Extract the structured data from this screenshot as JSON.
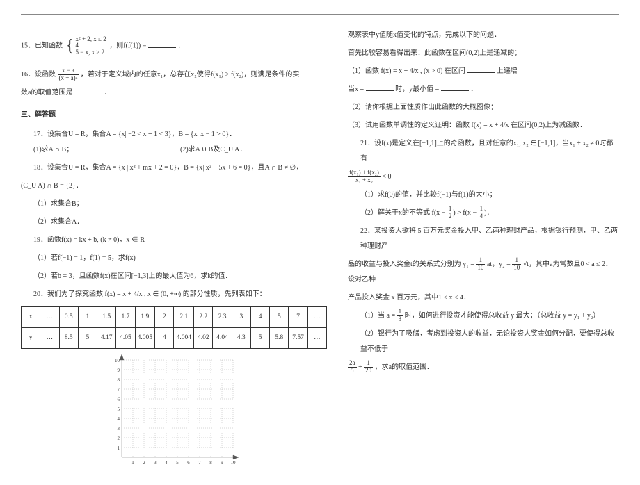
{
  "q15": {
    "prefix": "15．已知函数",
    "fn": "f(x) = ",
    "piece1": "x² + 2, x ≤ 2",
    "piece2": "4",
    "piece3": "5 − x, x > 2",
    "mid": "，则f(f(1)) = ",
    "suffix": "．"
  },
  "q16": {
    "prefix": "16．设函数",
    "fn": "f(x) = (x − a) / (x + a)²",
    "body": "，若对于定义域内的任意x₁，总存在x₂使得f(x₁) > f(x₂)，则满足条件的实",
    "line2": "数a的取值范围是",
    "suffix": "．"
  },
  "sec3": "三、解答题",
  "q17": {
    "line1": "17．设集合U = R，集合A = {x| −2 < x + 1 < 3}，B = {x| x − 1 > 0}．",
    "part1": "(1)求A ∩ B；",
    "part2": "(2)求A ∪ B及C_U A．"
  },
  "q18": {
    "line1": "18．设集合U = R，集合A = {x | x² + mx + 2 = 0}，B = {x| x² − 5x + 6 = 0}，且A ∩ B ≠ ∅，",
    "line2": "(C_U A) ∩ B = {2}．",
    "part1": "（1）求集合B；",
    "part2": "（2）求集合A．"
  },
  "q19": {
    "line1": "19．函数f(x) = kx + b, (k ≠ 0)，x ∈ R",
    "part1": "（1）若f(−1) = 1，f(1) = 5，求f(x)",
    "part2": "（2）若b = 3，且函数f(x)在区间[−1,3]上的最大值为6，求k的值．"
  },
  "q20": {
    "line1_pre": "20．我们为了探究函数",
    "fn": "f(x) = x + 4/x , x ∈ (0, +∞)",
    "line1_post": "的部分性质，先列表如下：",
    "table": {
      "row_x_label": "x",
      "row_y_label": "y",
      "dots": "…",
      "x": [
        "0.5",
        "1",
        "1.5",
        "1.7",
        "1.9",
        "2",
        "2.1",
        "2.2",
        "2.3",
        "3",
        "4",
        "5",
        "7"
      ],
      "y": [
        "8.5",
        "5",
        "4.17",
        "4.05",
        "4.005",
        "4",
        "4.004",
        "4.02",
        "4.04",
        "4.3",
        "5",
        "5.8",
        "7.57"
      ]
    }
  },
  "right": {
    "r1": "观察表中y值随x值变化的特点，完成以下的问题．",
    "r2": "首先比较容易看得出来：此函数在区间(0,2)上是递减的；",
    "r3_pre": "（1）函数",
    "r3_fn": "f(x) = x + 4/x , (x > 0)",
    "r3_mid": "在区间",
    "r3_post": "上递增",
    "r4_a": "当x = ",
    "r4_b": "时，y最小值 = ",
    "r4_c": "．",
    "r5": "（2）请你根据上面性质作出此函数的大概图像；",
    "r6_pre": "（3）试用函数单调性的定义证明：函数",
    "r6_fn": "f(x) = x + 4/x",
    "r6_post": "在区间(0,2)上为减函数．",
    "q21_l1": "21．设f(x)是定义在[−1,1]上的奇函数，且对任意的x₁, x₂ ∈ [−1,1]，当x₁ + x₂ ≠ 0时都有",
    "q21_frac_num": "f(x₁) + f(x₂)",
    "q21_frac_den": "x₁ + x₂",
    "q21_lt": " < 0",
    "q21_p1": "（1）求f(0)的值，并比较f(−1)与f(1)的大小；",
    "q21_p2_pre": "（2）解关于x的不等式",
    "q21_p2_f1n": "1",
    "q21_p2_f1d": "2",
    "q21_p2_mid": "f(x − ) > f(x − )",
    "q21_p2_f2n": "1",
    "q21_p2_f2d": "4",
    "q22_l1": "22．某投资人欲将 5 百万元奖金投入甲、乙两种理财产品，根据银行预测，甲、乙两种理财产",
    "q22_l2_pre": "品的收益与投入奖金t的关系式分别为 y₁ = ",
    "q22_f1n": "1",
    "q22_f1d": "10",
    "q22_l2_mid1": "at，y₂ = ",
    "q22_f2n": "1",
    "q22_f2d": "10",
    "q22_l2_mid2": "√t，其中a为常数且0 < a ≤ 2．设对乙种",
    "q22_l3": "产品投入奖金 x 百万元，其中1 ≤ x ≤ 4．",
    "q22_p1_pre": "（1）当 a = ",
    "q22_p1_fn": "1",
    "q22_p1_fd": "3",
    "q22_p1_post": " 时，如何进行投资才能使得总收益 y 最大；（总收益 y = y₁ + y₂）",
    "q22_p2": "（2）银行为了吸储，考虑到投资人的收益，无论投资人奖金如何分配，要使得总收益不低于",
    "q22_p3_f1n": "2a",
    "q22_p3_f1d": "5",
    "q22_p3_plus": " + ",
    "q22_p3_f2n": "1",
    "q22_p3_f2d": "20",
    "q22_p3_post": "，求a的取值范围．"
  },
  "chart_data": {
    "type": "scatter",
    "title": "",
    "xlabel": "",
    "ylabel": "",
    "xlim": [
      0,
      10
    ],
    "ylim": [
      0,
      10
    ],
    "x_ticks": [
      1,
      2,
      3,
      4,
      5,
      6,
      7,
      8,
      9,
      10
    ],
    "y_ticks": [
      1,
      2,
      3,
      4,
      5,
      6,
      7,
      8,
      9,
      10
    ],
    "series": []
  }
}
